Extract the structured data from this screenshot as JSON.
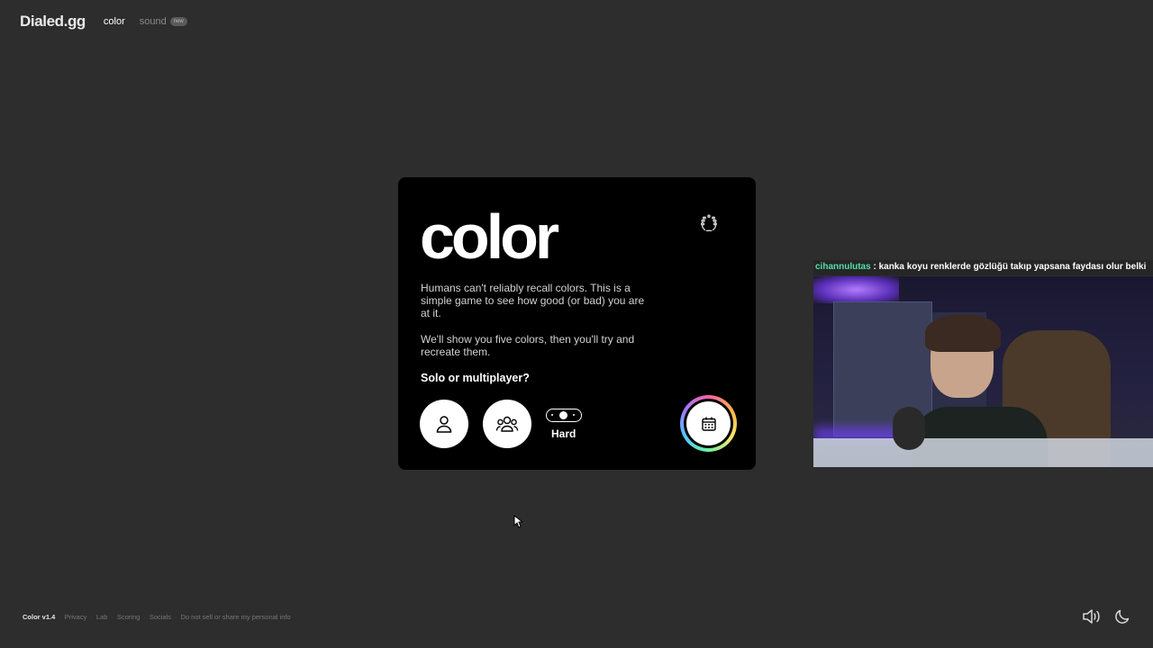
{
  "header": {
    "logo": "Dialed.gg",
    "nav": [
      {
        "label": "color",
        "active": true
      },
      {
        "label": "sound",
        "active": false,
        "badge": "new"
      }
    ]
  },
  "card": {
    "title": "color",
    "laurel_icon": "laurel-icon",
    "description": [
      "Humans can't reliably recall colors. This is a simple game to see how good (or bad) you are at it.",
      "We'll show you five colors, then you'll try and recreate them."
    ],
    "question": "Solo or multiplayer?",
    "buttons": {
      "solo_icon": "person-icon",
      "multiplayer_icon": "group-icon",
      "difficulty_label": "Hard",
      "daily_icon": "calendar-icon"
    }
  },
  "stream": {
    "chat_user": "cihannulutas",
    "chat_separator": " : ",
    "chat_message": "kanka koyu renklerde gözlüğü takıp yapsana faydası olur belki"
  },
  "footer": {
    "version": "Color v1.4",
    "links": [
      "Privacy",
      "Lab",
      "Scoring",
      "Socials",
      "Do not sell or share my personal info"
    ],
    "sound_icon": "speaker-icon",
    "theme_icon": "moon-icon"
  },
  "colors": {
    "background": "#2d2d2d",
    "card": "#000000",
    "chat_username": "#4fe0a8"
  }
}
